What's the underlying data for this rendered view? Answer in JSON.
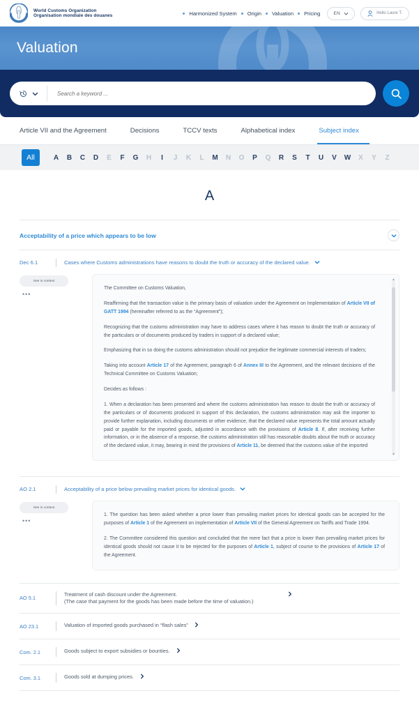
{
  "header": {
    "brand": {
      "line1": "World Customs Organization",
      "line2": "Organisation mondiale des douanes",
      "logo_icon": "wco-logo-icon"
    },
    "nav_links": [
      "Harmonized System",
      "Origin",
      "Valuation",
      "Pricing"
    ],
    "language": {
      "label": "EN",
      "icon": "chevron-down-icon"
    },
    "user": {
      "label": "Hello Laure T.",
      "icon": "user-icon"
    }
  },
  "hero": {
    "title": "Valuation",
    "watermark_icon": "wco-logo-watermark-icon"
  },
  "search": {
    "history_icon": "history-clock-icon",
    "history_chevron_icon": "chevron-down-icon",
    "placeholder": "Search a keyword ...",
    "value": "",
    "submit_icon": "search-icon"
  },
  "tabs": [
    {
      "label": "Article VII and the Agreement",
      "active": false
    },
    {
      "label": "Decisions",
      "active": false
    },
    {
      "label": "TCCV texts",
      "active": false
    },
    {
      "label": "Alphabetical index",
      "active": false
    },
    {
      "label": "Subject index",
      "active": true
    }
  ],
  "alphabet": {
    "all_label": "All",
    "letters": [
      {
        "l": "A",
        "enabled": true
      },
      {
        "l": "B",
        "enabled": true
      },
      {
        "l": "C",
        "enabled": true
      },
      {
        "l": "D",
        "enabled": true
      },
      {
        "l": "E",
        "enabled": false
      },
      {
        "l": "F",
        "enabled": true
      },
      {
        "l": "G",
        "enabled": true
      },
      {
        "l": "H",
        "enabled": false
      },
      {
        "l": "I",
        "enabled": true
      },
      {
        "l": "J",
        "enabled": false
      },
      {
        "l": "K",
        "enabled": false
      },
      {
        "l": "L",
        "enabled": false
      },
      {
        "l": "M",
        "enabled": true
      },
      {
        "l": "N",
        "enabled": false
      },
      {
        "l": "O",
        "enabled": false
      },
      {
        "l": "P",
        "enabled": true
      },
      {
        "l": "Q",
        "enabled": false
      },
      {
        "l": "R",
        "enabled": true
      },
      {
        "l": "S",
        "enabled": true
      },
      {
        "l": "T",
        "enabled": true
      },
      {
        "l": "U",
        "enabled": true
      },
      {
        "l": "V",
        "enabled": true
      },
      {
        "l": "W",
        "enabled": true
      },
      {
        "l": "X",
        "enabled": false
      },
      {
        "l": "Y",
        "enabled": false
      },
      {
        "l": "Z",
        "enabled": false
      }
    ]
  },
  "main": {
    "letter_heading": "A",
    "subject": {
      "title": "Acceptability of a price which appears to be low",
      "toggle_icon": "chevron-down-icon"
    },
    "entry1": {
      "ref": "Dec 6.1",
      "title": "Cases where Customs administrations have reasons to doubt the truth or accuracy of the declared value.",
      "chevron_icon": "chevron-down-icon",
      "context_button": "See in context",
      "more_icon": "ellipsis-icon",
      "paragraphs": [
        {
          "parts": [
            {
              "t": "The Committee on Customs Valuation,"
            }
          ]
        },
        {
          "parts": [
            {
              "t": "Reaffirming that the transaction value is the primary basis of valuation under the Agreement on Implementation of "
            },
            {
              "t": "Article VII of GATT 1994",
              "link": true
            },
            {
              "t": " (hereinafter referred to as the “Agreement”);"
            }
          ]
        },
        {
          "parts": [
            {
              "t": "Recognizing that the customs administration may have to address cases where it has reason to doubt the truth or accuracy of the particulars or of documents produced by traders in support of a declared value;"
            }
          ]
        },
        {
          "parts": [
            {
              "t": "Emphasizing that in so doing the customs administration should not prejudice the legitimate commercial interests of traders;"
            }
          ]
        },
        {
          "parts": [
            {
              "t": "Taking into account "
            },
            {
              "t": "Article 17",
              "link": true
            },
            {
              "t": " of the Agreement, paragraph 6 of "
            },
            {
              "t": "Annex III",
              "link": true
            },
            {
              "t": " to the Agreement, and the relevant decisions of the Technical Committee on Customs Valuation;"
            }
          ]
        },
        {
          "parts": [
            {
              "t": "Decides as follows :"
            }
          ]
        },
        {
          "parts": [
            {
              "t": "1. When a declaration has been presented and where the customs administration has reason to doubt the truth or accuracy of the particulars or of documents produced in support of this declaration, the customs administration may ask the importer to provide further explanation, including documents or other evidence, that the declared value represents the total amount actually paid or payable for the imported goods, adjusted in accordance with the provisions of "
            },
            {
              "t": "Article 8",
              "link": true
            },
            {
              "t": ".  If, after receiving further information, or in the absence of a response, the customs administration still has reasonable doubts about the truth or accuracy of the declared value, it may, bearing in mind the provisions of "
            },
            {
              "t": "Article 11",
              "link": true
            },
            {
              "t": ", be deemed that the customs value of the imported"
            }
          ]
        }
      ]
    },
    "entry2": {
      "ref": "AO 2.1",
      "title": "Acceptability of a price below prevailing market prices for identical goods.",
      "chevron_icon": "chevron-down-icon",
      "context_button": "See in context",
      "more_icon": "ellipsis-icon",
      "paragraphs": [
        {
          "parts": [
            {
              "t": "1. The question has been asked whether a price lower than prevailing market prices for identical goods can be accepted for the purposes of "
            },
            {
              "t": "Article 1",
              "link": true
            },
            {
              "t": " of the Agreement on implementation of "
            },
            {
              "t": "Article VII",
              "link": true
            },
            {
              "t": " of the General Agreement on Tariffs and Trade 1994."
            }
          ]
        },
        {
          "parts": [
            {
              "t": "2. The Committee considered this question and concluded that the mere fact that a price is lower than prevailing market prices for identical goods should not cause it to be rejected for the purposes of "
            },
            {
              "t": "Article 1",
              "link": true
            },
            {
              "t": ", subject of course to the provisions of "
            },
            {
              "t": "Article 17",
              "link": true
            },
            {
              "t": " of the Agreement."
            }
          ]
        }
      ]
    },
    "rows": [
      {
        "ref": "AO 5.1",
        "line1": "Treatment of cash discount under the Agreement.",
        "line2": "(The case that payment for the goods has been made before the time of valuation.)",
        "arrow_icon": "chevron-right-icon"
      },
      {
        "ref": "AO 23.1",
        "line1": "Valuation of imported goods purchased in “flash sales”",
        "line2": "",
        "arrow_icon": "chevron-right-icon"
      },
      {
        "ref": "Com. 2.1",
        "line1": "Goods subject to export subsidies or bounties.",
        "line2": "",
        "arrow_icon": "chevron-right-icon"
      },
      {
        "ref": "Com. 3.1",
        "line1": "Goods sold at dumping prices.",
        "line2": "",
        "arrow_icon": "chevron-right-icon"
      }
    ]
  },
  "colors": {
    "brand_navy": "#102c63",
    "accent_blue": "#2f8ad6",
    "hero_blue": "#5a94d0",
    "alpha_active": "#1380d4"
  }
}
